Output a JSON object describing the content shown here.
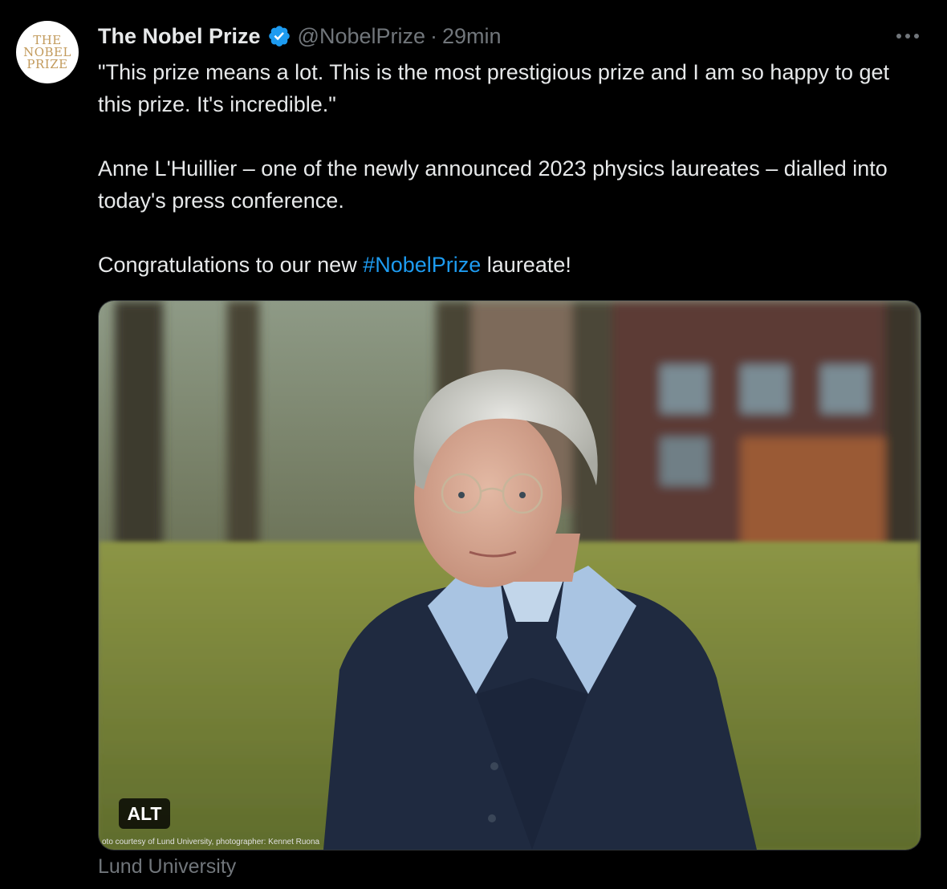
{
  "author": {
    "display_name": "The Nobel Prize",
    "handle": "@NobelPrize",
    "separator": "·",
    "timestamp": "29min",
    "verified": true,
    "avatar_logo": [
      "THE",
      "NOBEL",
      "PRIZE"
    ]
  },
  "tweet": {
    "paragraph_1": "\"This prize means a lot. This is the most prestigious prize and I am so happy to get this prize. It's incredible.\"",
    "paragraph_2": "Anne L'Huillier – one of the newly announced 2023 physics laureates – dialled into today's press conference.",
    "paragraph_3_before": "Congratulations to our new ",
    "paragraph_3_hashtag": "#NobelPrize",
    "paragraph_3_after": " laureate!"
  },
  "media": {
    "alt_badge": "ALT",
    "photo_credit": "oto courtesy of Lund University, photographer: Kennet Ruona"
  },
  "card_source": "Lund University",
  "icons": {
    "more": "more-horizontal-icon",
    "verified": "verified-badge-icon"
  },
  "colors": {
    "background": "#000000",
    "text": "#e7e9ea",
    "muted": "#71767b",
    "link": "#1d9bf0",
    "verified": "#1d9bf0",
    "logo_gold": "#c29a5b"
  }
}
